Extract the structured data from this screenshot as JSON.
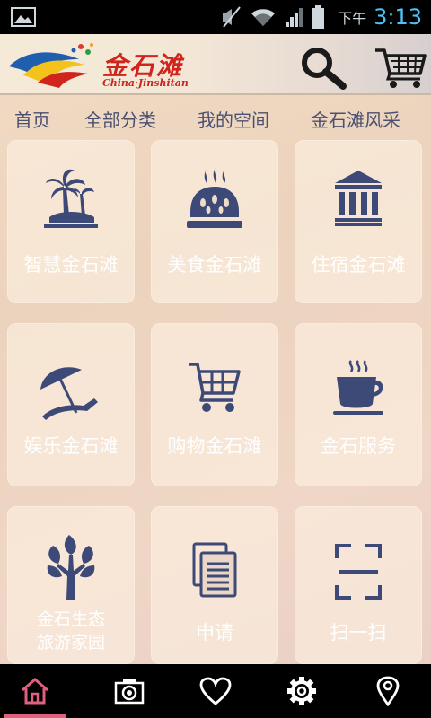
{
  "status_bar": {
    "ampm": "下午",
    "time": "3:13",
    "icons": [
      "gallery-icon",
      "mute-icon",
      "wifi-icon",
      "signal-icon",
      "battery-icon"
    ]
  },
  "header": {
    "logo_title": "金石滩",
    "logo_subtitle": "China·Jinshitan",
    "search_icon": "search-icon",
    "cart_icon": "cart-icon"
  },
  "nav": {
    "items": [
      "首页",
      "全部分类",
      "我的空间",
      "金石滩风采"
    ]
  },
  "tiles": [
    {
      "label": "智慧金石滩",
      "icon": "palm-island-icon"
    },
    {
      "label": "美食金石滩",
      "icon": "bread-icon"
    },
    {
      "label": "住宿金石滩",
      "icon": "building-icon"
    },
    {
      "label": "娱乐金石滩",
      "icon": "beach-umbrella-icon"
    },
    {
      "label": "购物金石滩",
      "icon": "shopping-cart-icon"
    },
    {
      "label": "金石服务",
      "icon": "coffee-cup-icon"
    },
    {
      "label_line1": "金石生态",
      "label_line2": "旅游家园",
      "icon": "tree-icon"
    },
    {
      "label": "申请",
      "icon": "documents-icon"
    },
    {
      "label": "扫一扫",
      "icon": "scan-icon"
    }
  ],
  "bottom_tabs": [
    "home-icon",
    "camera-icon",
    "heart-icon",
    "gear-icon",
    "location-pin-icon"
  ],
  "colors": {
    "icon": "#3d4a78",
    "accent": "#e06080",
    "clock": "#4fc3f7",
    "logo_red": "#d0241c"
  }
}
